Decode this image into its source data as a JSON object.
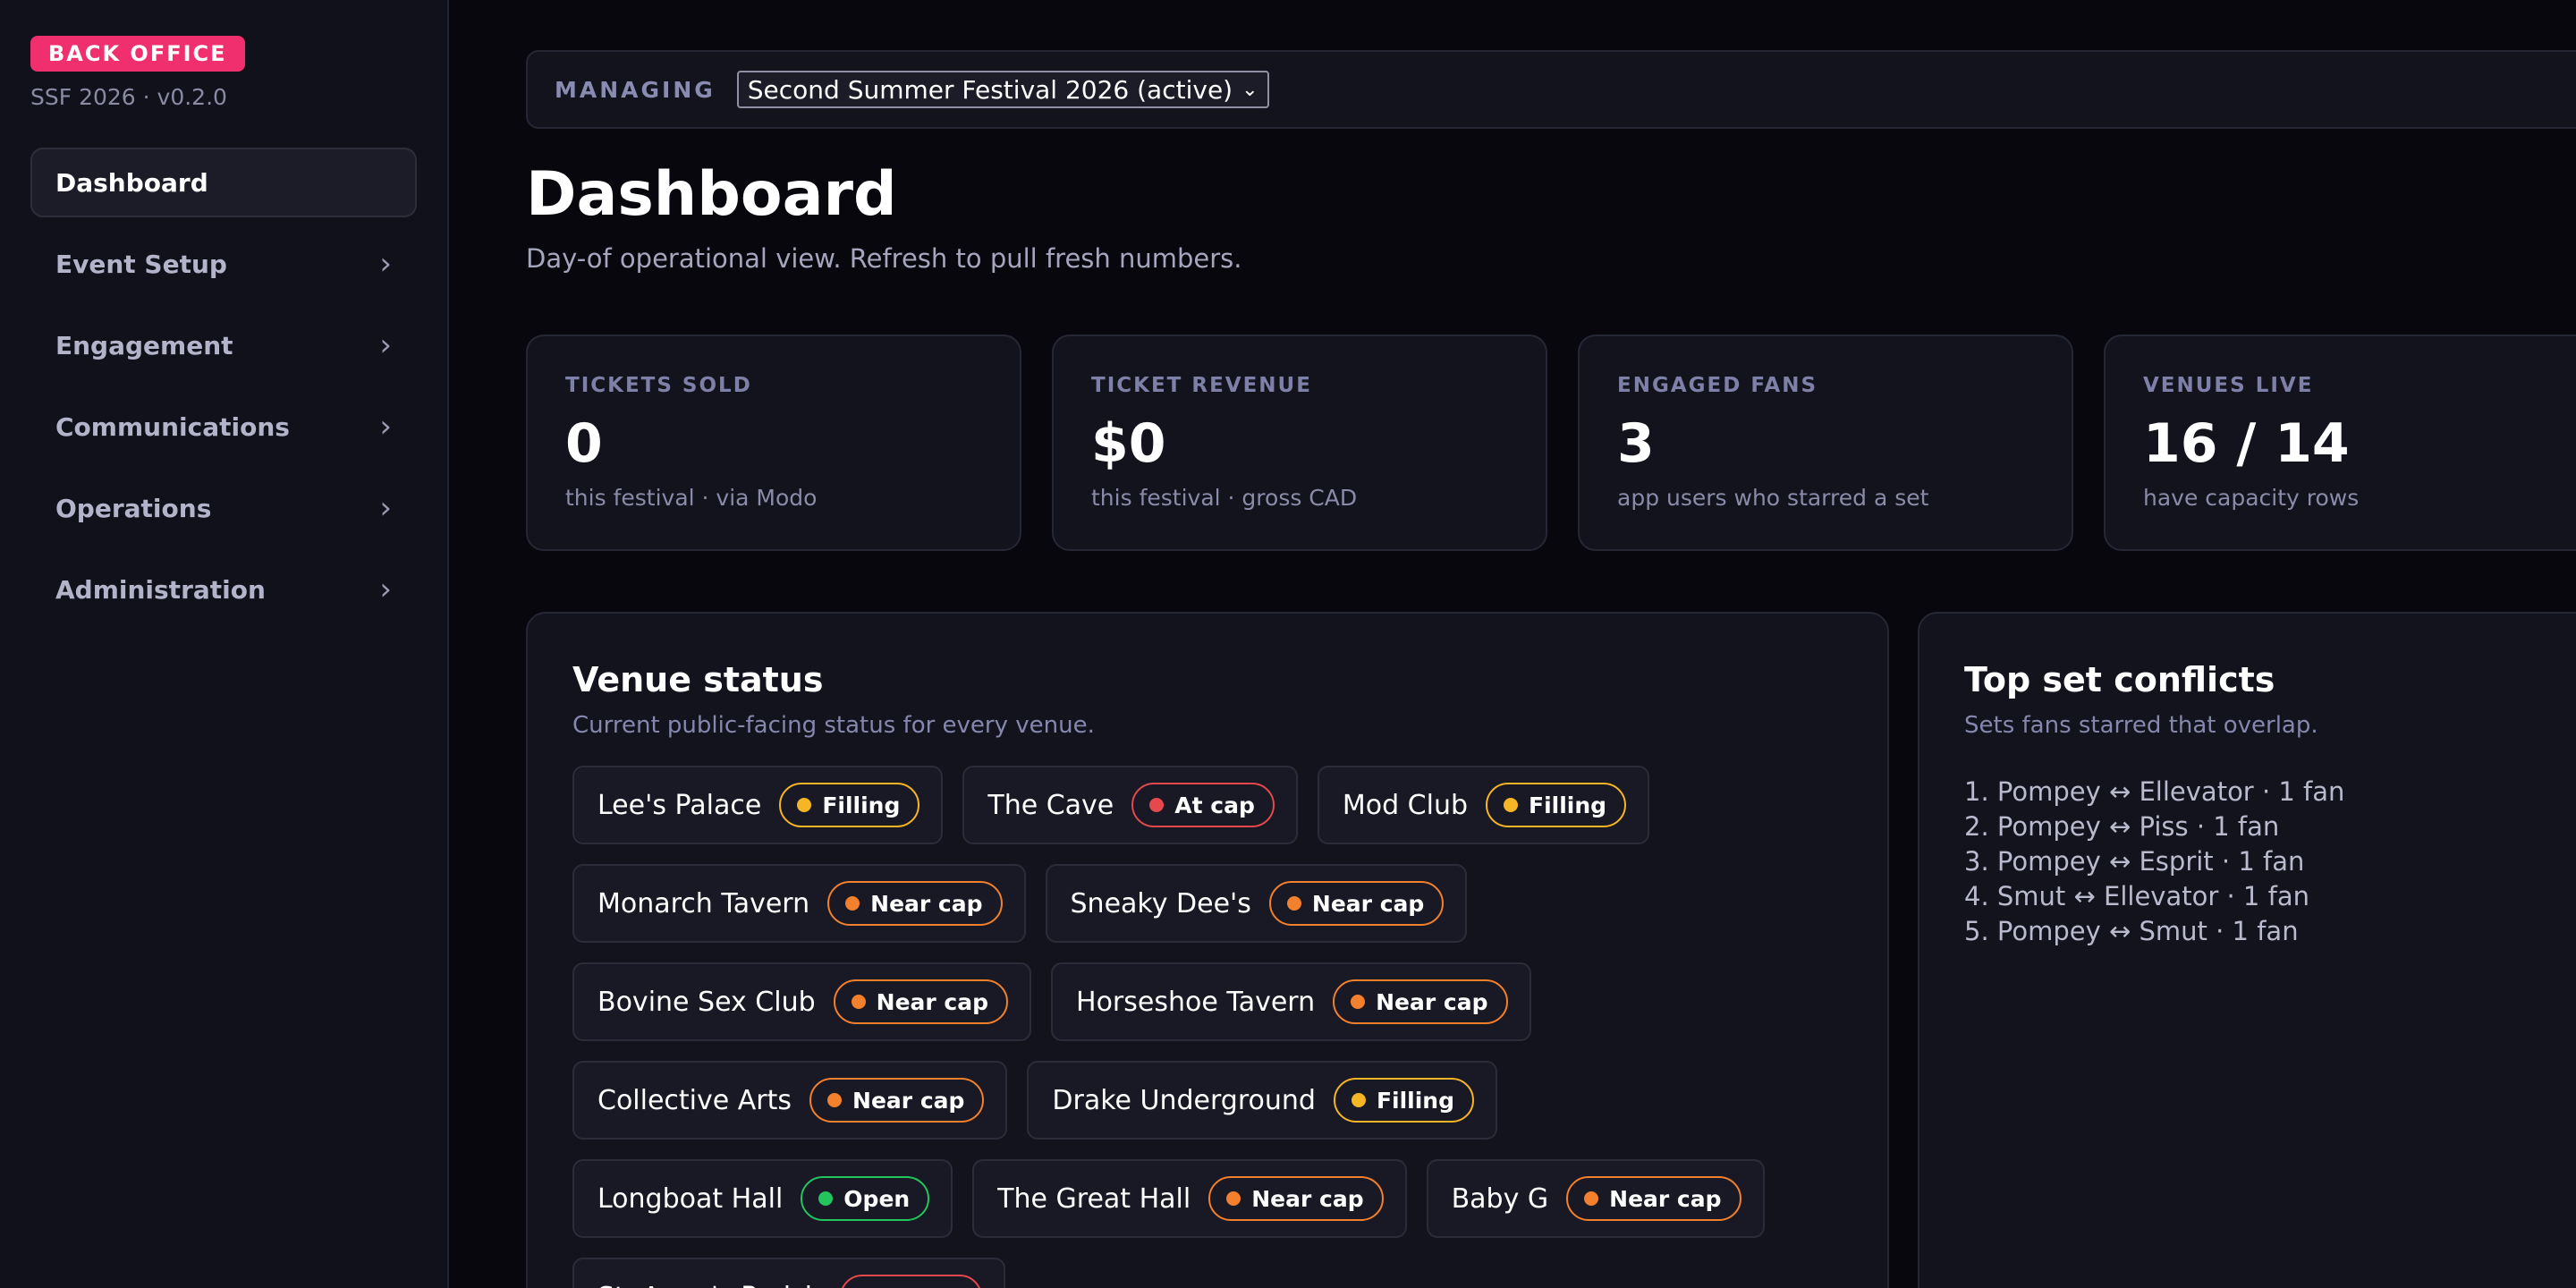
{
  "brand": {
    "badge": "BACK OFFICE",
    "version": "SSF 2026 · v0.2.0"
  },
  "nav": [
    {
      "label": "Dashboard",
      "active": true,
      "has_children": false
    },
    {
      "label": "Event Setup",
      "active": false,
      "has_children": true
    },
    {
      "label": "Engagement",
      "active": false,
      "has_children": true
    },
    {
      "label": "Communications",
      "active": false,
      "has_children": true
    },
    {
      "label": "Operations",
      "active": false,
      "has_children": true
    },
    {
      "label": "Administration",
      "active": false,
      "has_children": true
    }
  ],
  "managing": {
    "label": "MANAGING",
    "selected_festival": "Second Summer Festival 2026 (active)"
  },
  "page": {
    "title": "Dashboard",
    "subtitle": "Day-of operational view. Refresh to pull fresh numbers."
  },
  "stats": [
    {
      "label": "TICKETS SOLD",
      "value": "0",
      "note": "this festival · via Modo"
    },
    {
      "label": "TICKET REVENUE",
      "value": "$0",
      "note": "this festival · gross CAD"
    },
    {
      "label": "ENGAGED FANS",
      "value": "3",
      "note": "app users who starred a set"
    },
    {
      "label": "VENUES LIVE",
      "value": "16 / 14",
      "note": "have capacity rows"
    }
  ],
  "status_colors": {
    "Filling": "#f5b524",
    "At cap": "#e5484d",
    "Near cap": "#f2802c",
    "Open": "#22c55e"
  },
  "venue_panel": {
    "title": "Venue status",
    "subtitle": "Current public-facing status for every venue.",
    "venues": [
      {
        "name": "Lee's Palace",
        "status": "Filling"
      },
      {
        "name": "The Cave",
        "status": "At cap"
      },
      {
        "name": "Mod Club",
        "status": "Filling"
      },
      {
        "name": "Monarch Tavern",
        "status": "Near cap"
      },
      {
        "name": "Sneaky Dee's",
        "status": "Near cap"
      },
      {
        "name": "Bovine Sex Club",
        "status": "Near cap"
      },
      {
        "name": "Horseshoe Tavern",
        "status": "Near cap"
      },
      {
        "name": "Collective Arts",
        "status": "Near cap"
      },
      {
        "name": "Drake Underground",
        "status": "Filling"
      },
      {
        "name": "Longboat Hall",
        "status": "Open"
      },
      {
        "name": "The Great Hall",
        "status": "Near cap"
      },
      {
        "name": "Baby G",
        "status": "Near cap"
      },
      {
        "name": "St. Anne's Parish",
        "status": "At cap"
      }
    ]
  },
  "conflicts_panel": {
    "title": "Top set conflicts",
    "subtitle": "Sets fans starred that overlap.",
    "items": [
      "1. Pompey ↔ Ellevator · 1 fan",
      "2. Pompey ↔ Piss · 1 fan",
      "3. Pompey ↔ Esprit · 1 fan",
      "4. Smut ↔ Ellevator · 1 fan",
      "5. Pompey ↔ Smut · 1 fan"
    ]
  }
}
